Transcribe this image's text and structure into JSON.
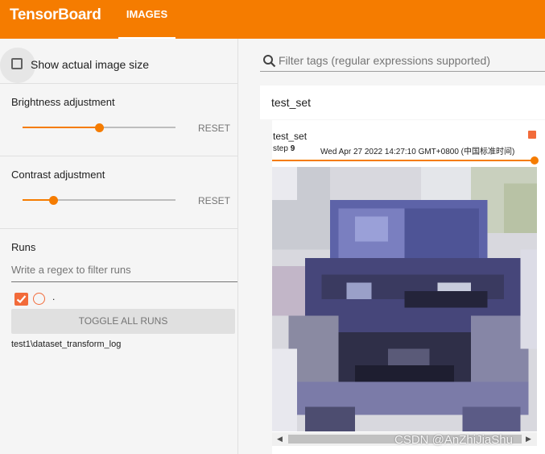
{
  "app": {
    "brand": "TensorBoard",
    "active_tab": "IMAGES"
  },
  "sidebar": {
    "actual_size_label": "Show actual image size",
    "actual_size_checked": false,
    "brightness": {
      "label": "Brightness adjustment",
      "reset": "RESET",
      "value": 0.5
    },
    "contrast": {
      "label": "Contrast adjustment",
      "reset": "RESET",
      "value": 0.2
    },
    "runs": {
      "title": "Runs",
      "filter_placeholder": "Write a regex to filter runs",
      "items": [
        {
          "name": ".",
          "checked": true,
          "color": "#f26b3a"
        }
      ],
      "toggle_all": "TOGGLE ALL RUNS",
      "logdir": "test1\\dataset_transform_log"
    }
  },
  "main": {
    "search_placeholder": "Filter tags (regular expressions supported)",
    "pane_title": "test_set",
    "card": {
      "tag": "test_set",
      "step_label": "step",
      "step": "9",
      "time": "Wed Apr 27 2022 14:27:10 GMT+0800 (中国标准时间)",
      "step_slider_value": 1.0
    }
  },
  "colors": {
    "accent": "#f57c00",
    "run": "#f26b3a"
  },
  "icons": {
    "search": "search-icon",
    "check": "check-icon"
  },
  "watermark": "CSDN @AnZhiJiaShu"
}
